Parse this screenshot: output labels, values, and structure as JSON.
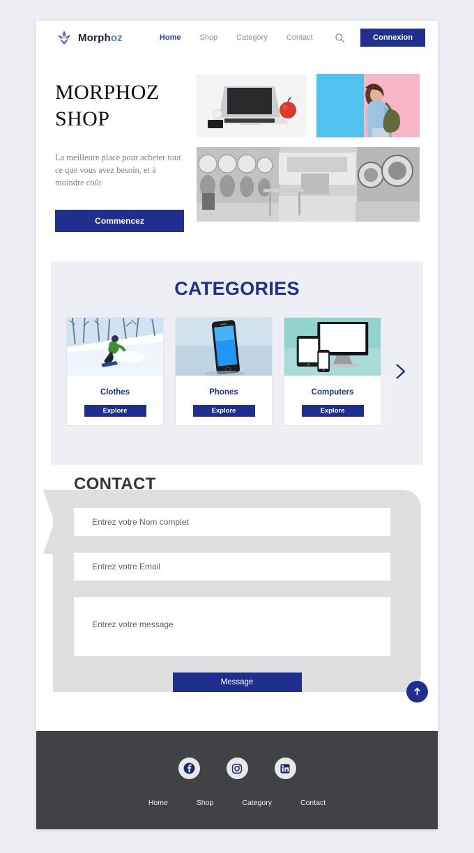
{
  "brand": {
    "name_dark": "Morph",
    "name_light": "oz",
    "logo_icon": "lotus-logo-icon"
  },
  "header": {
    "nav": [
      {
        "label": "Home",
        "active": true
      },
      {
        "label": "Shop",
        "active": false
      },
      {
        "label": "Category",
        "active": false
      },
      {
        "label": "Contact",
        "active": false
      }
    ],
    "search_icon": "search-icon",
    "login_label": "Connexion"
  },
  "hero": {
    "title_line1": "MORPHOZ",
    "title_line2": "SHOP",
    "subtitle": "La meilleure place pour acheter tout ce que vous avez besoin, et à moindre coût",
    "cta_label": "Commencez",
    "images": [
      {
        "name": "laptop-apple-photo",
        "alt": "Laptop with apple and phone"
      },
      {
        "name": "girl-denim-photo",
        "alt": "Girl in denim jacket on blue and pink wall"
      },
      {
        "name": "laundromat-photo",
        "alt": "Black and white laundromat interior"
      }
    ]
  },
  "categories": {
    "title": "CATEGORIES",
    "next_icon": "chevron-right-icon",
    "cards": [
      {
        "label": "Clothes",
        "button": "Explore",
        "image": "skier-photo"
      },
      {
        "label": "Phones",
        "button": "Explore",
        "image": "smartphone-photo"
      },
      {
        "label": "Computers",
        "button": "Explore",
        "image": "devices-photo"
      }
    ]
  },
  "contact": {
    "title": "CONTACT",
    "name_placeholder": "Entrez votre Nom complet",
    "email_placeholder": "Entrez votre Email",
    "message_placeholder": "Entrez votre message",
    "submit_label": "Message",
    "scroll_top_icon": "arrow-up-icon"
  },
  "footer": {
    "socials": [
      {
        "name": "facebook-icon"
      },
      {
        "name": "instagram-icon"
      },
      {
        "name": "linkedin-icon"
      }
    ],
    "links": [
      {
        "label": "Home"
      },
      {
        "label": "Shop"
      },
      {
        "label": "Category"
      },
      {
        "label": "Contact"
      }
    ]
  },
  "colors": {
    "brand_navy": "#1f2f8f",
    "page_bg": "#eceef3",
    "categories_bg": "#edeff4",
    "bubble_gray": "#dedfe1",
    "footer_gray": "#414245"
  }
}
